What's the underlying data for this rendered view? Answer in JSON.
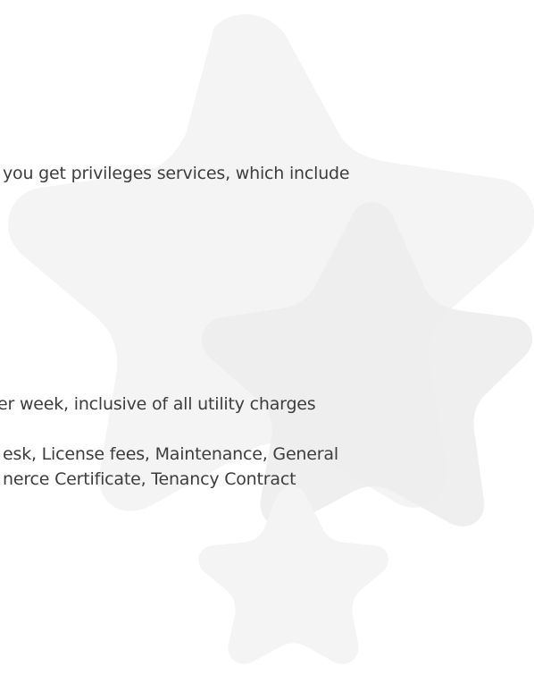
{
  "content": {
    "line1": "you get privileges services, which include",
    "line2": "er week, inclusive of all utility charges",
    "line3": "esk, License fees, Maintenance, General",
    "line4": "nerce Certificate, Tenancy Contract"
  },
  "colors": {
    "text": "#3d3d3d",
    "star_light": "#f4f4f4",
    "star_mid": "#ececec",
    "background": "#ffffff"
  }
}
